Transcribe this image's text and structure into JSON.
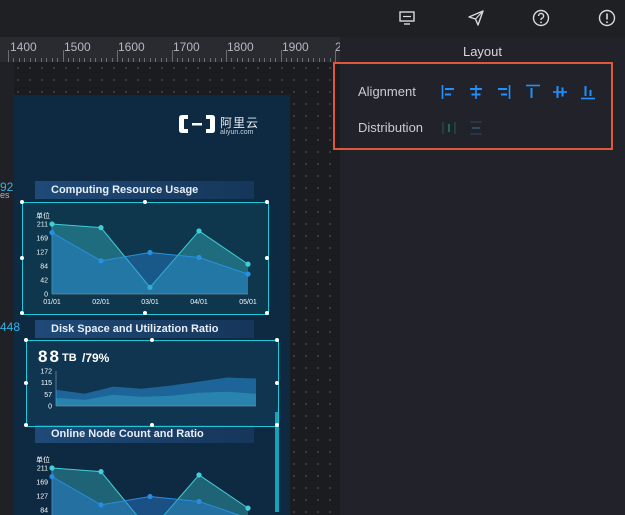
{
  "topbar": {
    "icons": [
      "comment-icon",
      "send-icon",
      "help-icon",
      "alert-icon"
    ]
  },
  "ruler": {
    "labels": [
      "1400",
      "1500",
      "1600",
      "1700",
      "1800",
      "1900",
      "2"
    ]
  },
  "board": {
    "logo": {
      "name_cn": "阿里云",
      "name_en": "aliyun.com"
    },
    "edge_numbers": [
      "92",
      "448"
    ],
    "edge_fragment": "es",
    "panels": [
      {
        "title": "Computing Resource Usage"
      },
      {
        "title": "Disk Space and Utilization Ratio"
      },
      {
        "title": "Online Node Count and Ratio"
      }
    ],
    "disk_metric": {
      "value": "88",
      "unit": "TB",
      "ratio": "/79%"
    }
  },
  "chart_data": [
    {
      "type": "area",
      "title": "Computing Resource Usage",
      "ylabel": "单位",
      "y_ticks": [
        "211",
        "169",
        "127",
        "84",
        "42",
        "0"
      ],
      "categories": [
        "01/01",
        "02/01",
        "03/01",
        "04/01",
        "05/01"
      ],
      "ylim": [
        0,
        211
      ],
      "series": [
        {
          "values": [
            211,
            200,
            20,
            190,
            90
          ]
        },
        {
          "values": [
            185,
            100,
            125,
            110,
            60
          ]
        }
      ]
    },
    {
      "type": "area",
      "title": "Disk Space and Utilization Ratio",
      "y_ticks": [
        "172",
        "115",
        "57",
        "0"
      ],
      "ylim": [
        0,
        172
      ],
      "series": [
        {
          "values": [
            80,
            60,
            95,
            85,
            100,
            120,
            140,
            135
          ]
        },
        {
          "values": [
            40,
            30,
            55,
            45,
            50,
            65,
            70,
            60
          ]
        }
      ]
    },
    {
      "type": "area",
      "title": "Online Node Count and Ratio",
      "ylabel": "单位",
      "y_ticks": [
        "211",
        "169",
        "127",
        "84"
      ],
      "ylim": [
        0,
        211
      ],
      "series": [
        {
          "values": [
            211,
            200,
            20,
            190,
            90
          ]
        },
        {
          "values": [
            185,
            100,
            125,
            110,
            60
          ]
        }
      ]
    }
  ],
  "right_panel": {
    "title": "Layout",
    "alignment_label": "Alignment",
    "distribution_label": "Distribution",
    "alignment_icons": [
      "align-left-icon",
      "align-center-horizontal-icon",
      "align-right-icon",
      "align-top-icon",
      "align-middle-vertical-icon",
      "align-bottom-icon"
    ],
    "distribution_icons": [
      "distribute-horizontal-icon",
      "distribute-vertical-icon"
    ]
  },
  "colors": {
    "accent": "#1e90ff",
    "highlight_border": "#e0573a",
    "chart_cyan": "#3fd0d8",
    "chart_blue": "#2a7fd4",
    "board_bg": "#0e2a42"
  }
}
